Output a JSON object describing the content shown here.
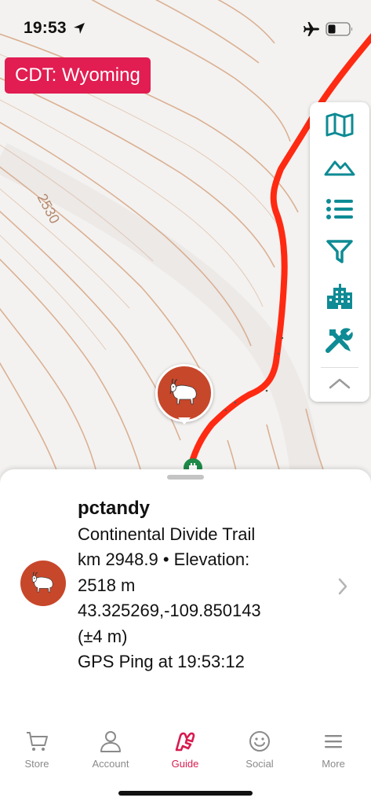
{
  "status_bar": {
    "time": "19:53",
    "icons": [
      "location-arrow-icon",
      "airplane-icon",
      "battery-icon"
    ]
  },
  "map": {
    "trail_label": "CDT: Wyoming",
    "contour_label": "2530",
    "trail_color": "#ff2a12",
    "contour_color": "#d9a98a",
    "toolbar": [
      "map-icon",
      "mountain-icon",
      "list-icon",
      "filter-icon",
      "city-icon",
      "tools-icon",
      "chevron-up-icon"
    ],
    "accent": "#0e8b94"
  },
  "info": {
    "name": "pctandy",
    "trail": "Continental Divide Trail",
    "km_line": "km 2948.9 • Elevation:",
    "elevation": "2518 m",
    "coordinates": "43.325269,-109.850143",
    "accuracy": "(±4 m)",
    "gps_ping": "GPS Ping at 19:53:12"
  },
  "tabs": [
    {
      "label": "Store",
      "icon": "cart-icon",
      "active": false
    },
    {
      "label": "Account",
      "icon": "person-icon",
      "active": false
    },
    {
      "label": "Guide",
      "icon": "guide-icon",
      "active": true
    },
    {
      "label": "Social",
      "icon": "smiley-icon",
      "active": false
    },
    {
      "label": "More",
      "icon": "menu-icon",
      "active": false
    }
  ],
  "colors": {
    "brand": "#e11d52",
    "avatar_bg": "#c7472b",
    "tab_inactive": "#8a8a8a"
  }
}
